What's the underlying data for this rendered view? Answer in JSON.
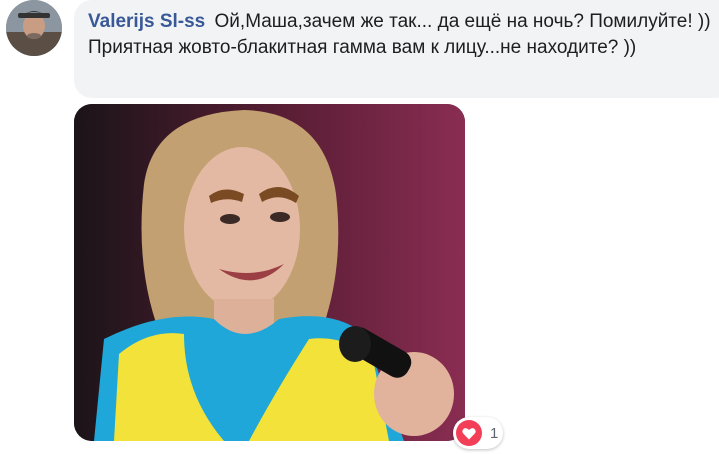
{
  "comment": {
    "author": "Valerijs Sl-ss",
    "text": "Ой,Маша,зачем же так... да ещё на ночь? Помилуйте! )) Приятная жовто-блакитная гамма вам к лицу...не находите? ))",
    "reaction_count": "1"
  },
  "icons": {
    "avatar": "user-avatar",
    "reaction": "heart-icon"
  },
  "colors": {
    "author": "#385898",
    "bubble": "#f2f3f5",
    "heart": "#f33e58",
    "yellow": "#f2e23a",
    "blue": "#1ea7d8"
  }
}
